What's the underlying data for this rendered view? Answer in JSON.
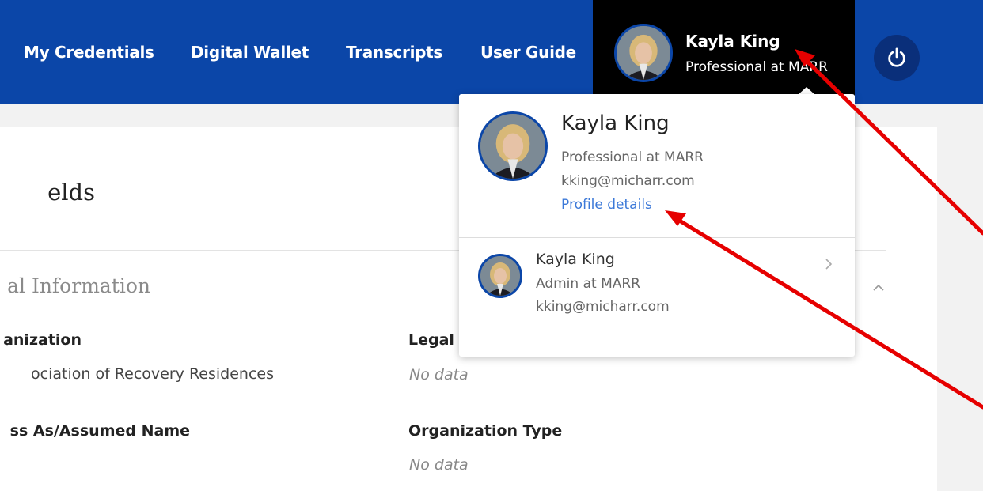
{
  "nav": {
    "items": [
      "My Credentials",
      "Digital Wallet",
      "Transcripts",
      "User Guide"
    ]
  },
  "user": {
    "name": "Kayla King",
    "role": "Professional at MARR"
  },
  "icons": {
    "power": "power-icon",
    "chevron_right": "chevron-right-icon",
    "chevron_up": "chevron-up-icon"
  },
  "dropdown": {
    "name": "Kayla King",
    "role": "Professional at MARR",
    "email": "kking@micharr.com",
    "profile_link": "Profile details",
    "alt_account": {
      "name": "Kayla King",
      "role": "Admin at MARR",
      "email": "kking@micharr.com"
    }
  },
  "page": {
    "section_title": "elds",
    "subsection_title": "al Information",
    "fields": [
      {
        "label": "anization",
        "value": "ociation of Recovery Residences"
      },
      {
        "label": "Legal",
        "value": "No data"
      },
      {
        "label": "ss As/Assumed Name",
        "value": ""
      },
      {
        "label": "Organization Type",
        "value": "No data"
      }
    ]
  },
  "colors": {
    "nav_bg": "#0b46a8",
    "user_bg": "#000000",
    "link": "#3b78d8",
    "annotation": "#e60000"
  }
}
